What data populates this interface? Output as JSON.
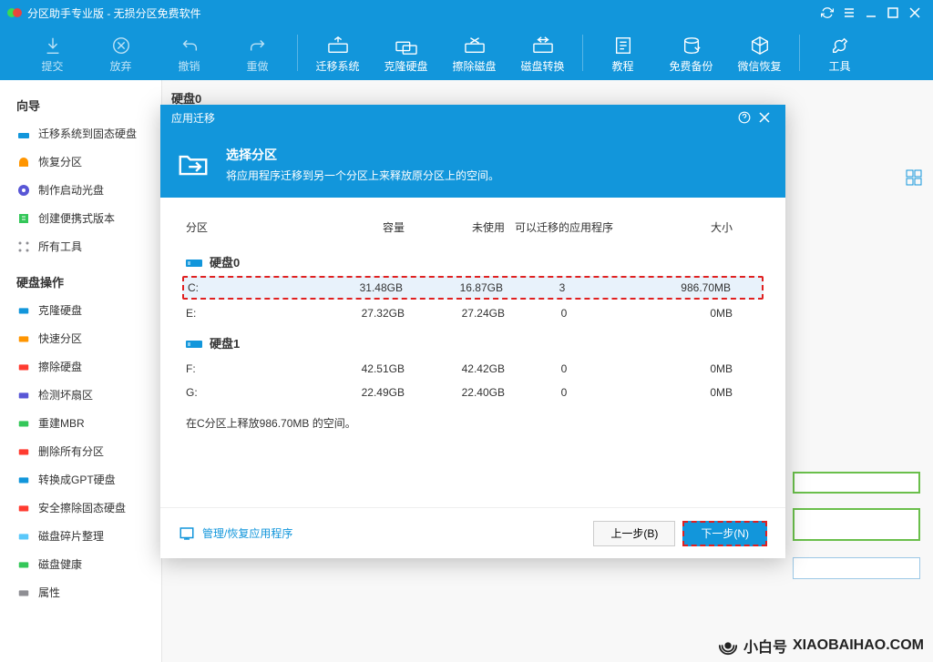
{
  "titlebar": {
    "title": "分区助手专业版 - 无损分区免费软件"
  },
  "toolbar": {
    "items": [
      {
        "label": "提交",
        "enabled": false
      },
      {
        "label": "放弃",
        "enabled": false
      },
      {
        "label": "撤销",
        "enabled": false
      },
      {
        "label": "重做",
        "enabled": false
      },
      {
        "label": "迁移系统",
        "enabled": true
      },
      {
        "label": "克隆硬盘",
        "enabled": true
      },
      {
        "label": "擦除磁盘",
        "enabled": true
      },
      {
        "label": "磁盘转换",
        "enabled": true
      },
      {
        "label": "教程",
        "enabled": true
      },
      {
        "label": "免费备份",
        "enabled": true
      },
      {
        "label": "微信恢复",
        "enabled": true
      },
      {
        "label": "工具",
        "enabled": true
      }
    ]
  },
  "sidebar": {
    "wizard_title": "向导",
    "wizard": [
      "迁移系统到固态硬盘",
      "恢复分区",
      "制作启动光盘",
      "创建便携式版本",
      "所有工具"
    ],
    "disk_title": "硬盘操作",
    "disk_ops": [
      "克隆硬盘",
      "快速分区",
      "擦除硬盘",
      "检测坏扇区",
      "重建MBR",
      "删除所有分区",
      "转换成GPT硬盘",
      "安全擦除固态硬盘",
      "磁盘碎片整理",
      "磁盘健康",
      "属性"
    ]
  },
  "content": {
    "disk0": "硬盘0"
  },
  "dialog": {
    "title": "应用迁移",
    "header_title": "选择分区",
    "header_sub": "将应用程序迁移到另一个分区上来释放原分区上的空间。",
    "columns": {
      "part": "分区",
      "cap": "容量",
      "unused": "未使用",
      "apps": "可以迁移的应用程序",
      "size": "大小"
    },
    "disks": [
      {
        "name": "硬盘0",
        "rows": [
          {
            "part": "C:",
            "cap": "31.48GB",
            "unused": "16.87GB",
            "apps": "3",
            "size": "986.70MB",
            "highlight": true
          },
          {
            "part": "E:",
            "cap": "27.32GB",
            "unused": "27.24GB",
            "apps": "0",
            "size": "0MB"
          }
        ]
      },
      {
        "name": "硬盘1",
        "rows": [
          {
            "part": "F:",
            "cap": "42.51GB",
            "unused": "42.42GB",
            "apps": "0",
            "size": "0MB"
          },
          {
            "part": "G:",
            "cap": "22.49GB",
            "unused": "22.40GB",
            "apps": "0",
            "size": "0MB"
          }
        ]
      }
    ],
    "status": "在C分区上释放986.70MB 的空间。",
    "manage": "管理/恢复应用程序",
    "back": "上一步(B)",
    "next": "下一步(N)"
  },
  "watermark": {
    "name": "小白号",
    "url": "XIAOBAIHAO.COM"
  }
}
